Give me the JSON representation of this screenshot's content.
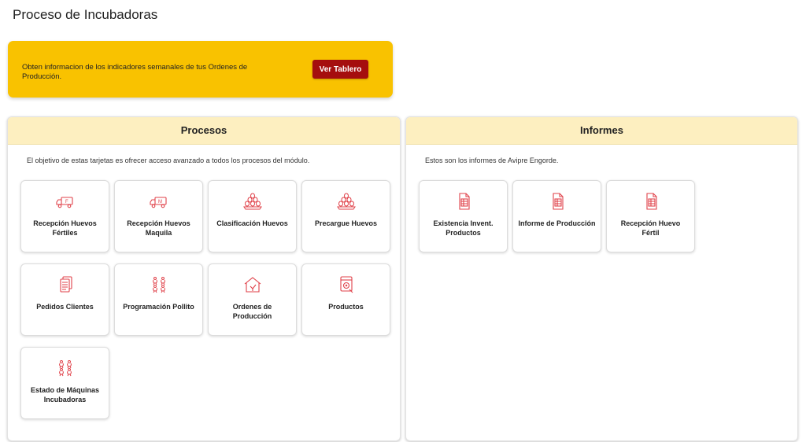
{
  "page": {
    "title": "Proceso de Incubadoras"
  },
  "banner": {
    "text": "Obten informacion de los indicadores semanales de tus Ordenes de Producción.",
    "button_label": "Ver Tablero"
  },
  "procesos": {
    "header": "Procesos",
    "description": "El objetivo de estas tarjetas es ofrecer acceso avanzado a todos los procesos del módulo.",
    "cards": [
      {
        "label": "Recepción Huevos Fértiles",
        "icon": "truck-f-icon"
      },
      {
        "label": "Recepción Huevos Maquila",
        "icon": "truck-m-icon"
      },
      {
        "label": "Clasificación Huevos",
        "icon": "eggs-icon"
      },
      {
        "label": "Precargue Huevos",
        "icon": "eggs-icon"
      },
      {
        "label": "Pedidos Clientes",
        "icon": "documents-icon"
      },
      {
        "label": "Programación Pollito",
        "icon": "chicks-icon"
      },
      {
        "label": "Ordenes de Producción",
        "icon": "house-icon"
      },
      {
        "label": "Productos",
        "icon": "product-box-icon"
      },
      {
        "label": "Estado de Máquinas Incubadoras",
        "icon": "chicks-icon"
      }
    ]
  },
  "informes": {
    "header": "Informes",
    "description": "Estos son los informes de Avipre Engorde.",
    "cards": [
      {
        "label": "Existencia Invent. Productos",
        "icon": "report-icon"
      },
      {
        "label": "Informe de Producción",
        "icon": "report-icon"
      },
      {
        "label": "Recepción Huevo Fértil",
        "icon": "report-icon"
      }
    ]
  },
  "colors": {
    "accent": "#a50e0e",
    "banner": "#f9c200",
    "header": "#fdefc0",
    "icon": "#e0424a"
  }
}
